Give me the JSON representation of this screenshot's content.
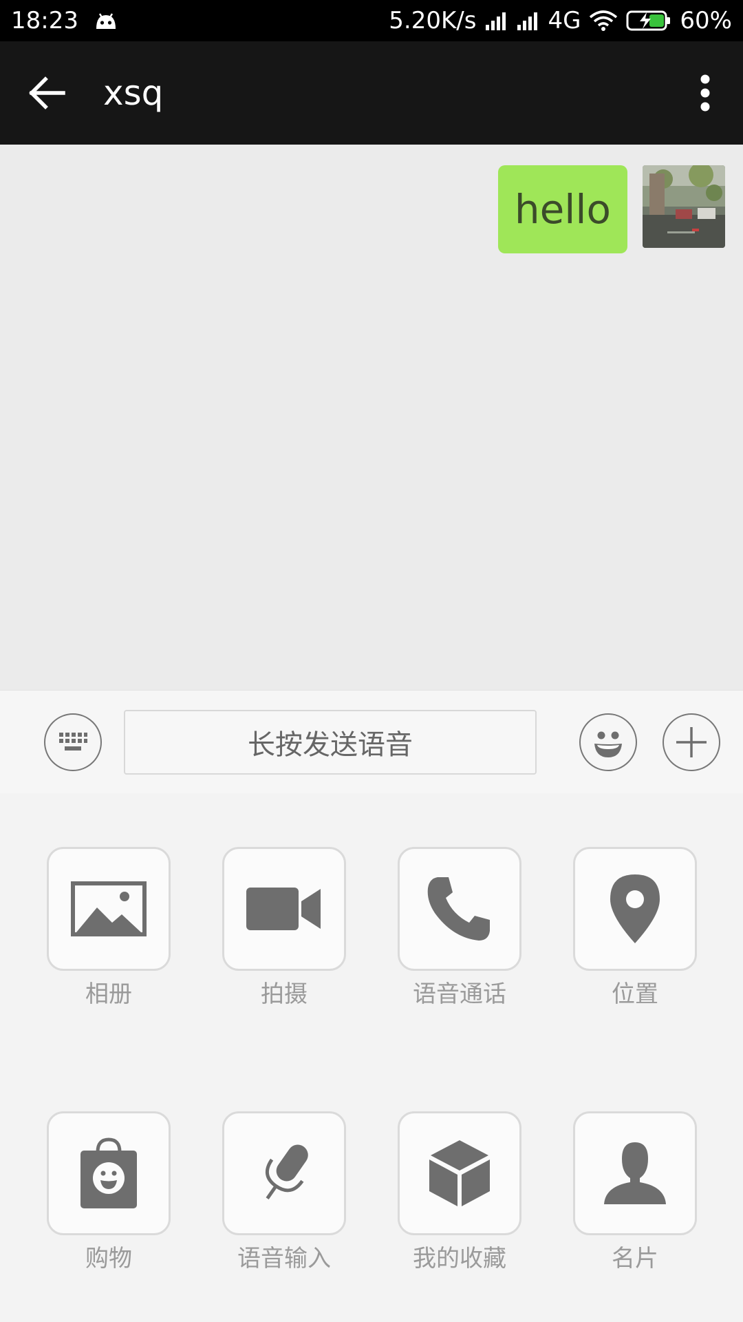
{
  "status_bar": {
    "time": "18:23",
    "network_speed": "5.20K/s",
    "network_type": "4G",
    "battery": "60%",
    "icons": [
      "android-icon",
      "signal-icon",
      "signal-icon",
      "wifi-icon",
      "battery-charging-icon"
    ]
  },
  "header": {
    "title": "xsq",
    "back_icon": "arrow-left-icon",
    "more_icon": "more-vertical-icon"
  },
  "messages": [
    {
      "text": "hello",
      "sender": "me",
      "bubble_color": "#9fe658"
    }
  ],
  "input_bar": {
    "voice_placeholder": "长按发送语音",
    "keyboard_icon": "keyboard-icon",
    "emoji_icon": "emoji-icon",
    "add_icon": "plus-icon"
  },
  "tools": [
    {
      "label": "相册",
      "icon": "gallery-icon"
    },
    {
      "label": "拍摄",
      "icon": "video-camera-icon"
    },
    {
      "label": "语音通话",
      "icon": "phone-icon"
    },
    {
      "label": "位置",
      "icon": "location-icon"
    },
    {
      "label": "购物",
      "icon": "shopping-bag-icon"
    },
    {
      "label": "语音输入",
      "icon": "microphone-icon"
    },
    {
      "label": "我的收藏",
      "icon": "cube-icon"
    },
    {
      "label": "名片",
      "icon": "contact-card-icon"
    }
  ],
  "colors": {
    "title_bar": "#161616",
    "chat_background": "#ebebeb",
    "bubble_green": "#9fe658",
    "icon_gray": "#6e6e6e"
  }
}
